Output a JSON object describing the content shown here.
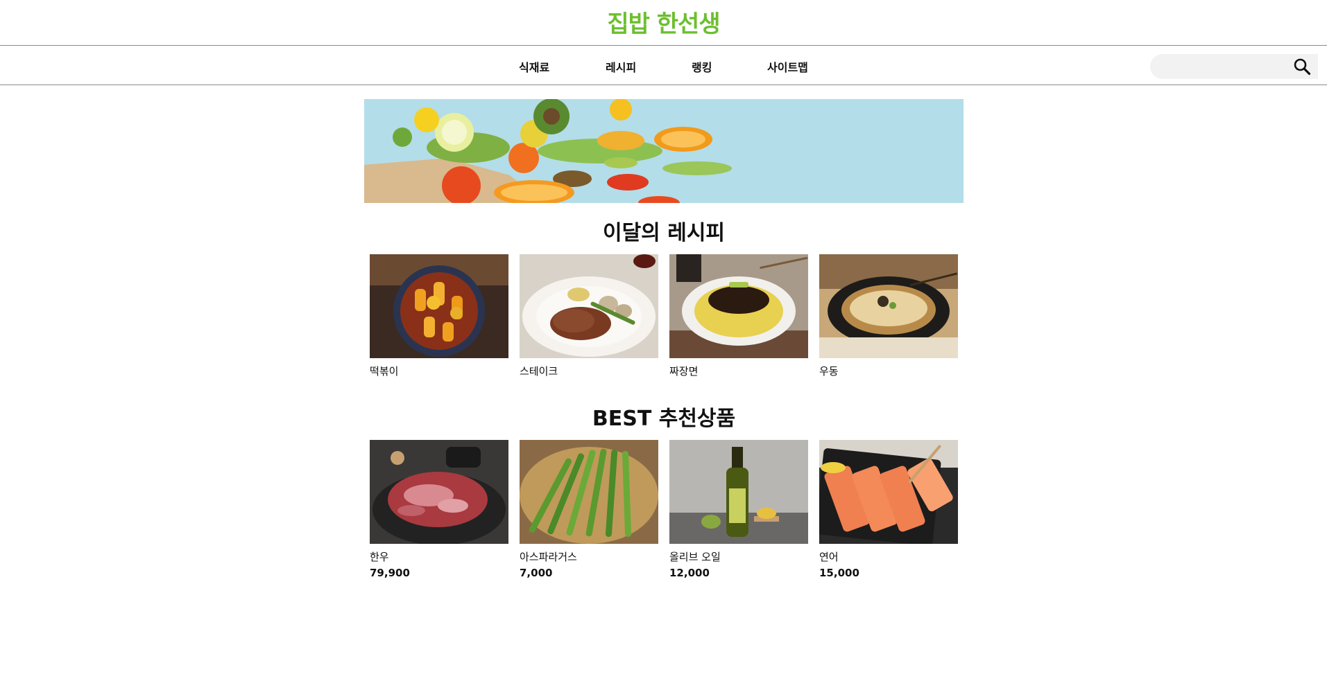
{
  "header": {
    "logo": "집밥 한선생",
    "logo_color": "#6cbf2e"
  },
  "nav": {
    "items": [
      {
        "label": "식재료"
      },
      {
        "label": "레시피"
      },
      {
        "label": "랭킹"
      },
      {
        "label": "사이트맵"
      }
    ],
    "search": {
      "placeholder": "",
      "icon": "search-icon"
    }
  },
  "banner": {
    "alt": "fresh-vegetables-and-fruits-banner"
  },
  "recipes": {
    "title": "이달의 레시피",
    "items": [
      {
        "name": "떡볶이"
      },
      {
        "name": "스테이크"
      },
      {
        "name": "짜장면"
      },
      {
        "name": "우동"
      }
    ]
  },
  "products": {
    "title": "BEST 추천상품",
    "items": [
      {
        "name": "한우",
        "price": "79,900"
      },
      {
        "name": "아스파라거스",
        "price": "7,000"
      },
      {
        "name": "올리브 오일",
        "price": "12,000"
      },
      {
        "name": "연어",
        "price": "15,000"
      }
    ]
  }
}
